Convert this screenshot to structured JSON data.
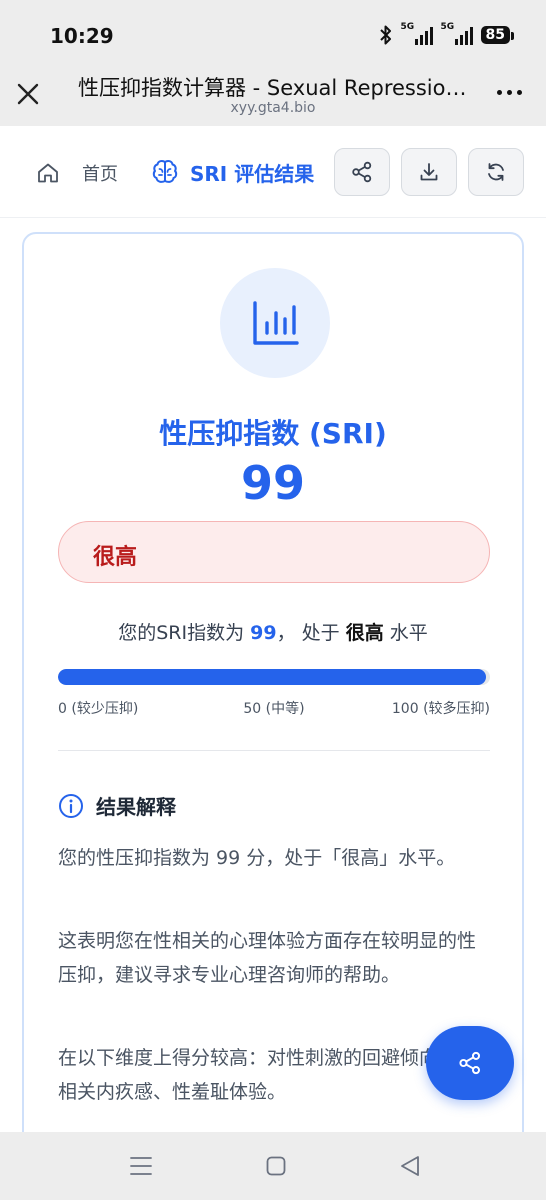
{
  "status_bar": {
    "time": "10:29",
    "network_1": "5G",
    "network_2": "5G",
    "battery": "85"
  },
  "browser": {
    "title": "性压抑指数计算器 - Sexual Repression Index",
    "url": "xyy.gta4.bio"
  },
  "nav": {
    "home_label": "首页",
    "current_label": "SRI 评估结果"
  },
  "result": {
    "title": "性压抑指数 (SRI)",
    "score": "99",
    "level": "很高",
    "summary_prefix": "您的SRI指数为",
    "summary_score": "99",
    "summary_middle": "， 处于",
    "summary_level": "很高",
    "summary_suffix": "水平",
    "progress_fraction": 0.99,
    "scale_low": "0 (较少压抑)",
    "scale_mid": "50 (中等)",
    "scale_high": "100 (较多压抑)"
  },
  "interpretation": {
    "heading": "结果解释",
    "paragraphs": [
      "您的性压抑指数为 99 分，处于「很高」水平。",
      "这表明您在性相关的心理体验方面存在较明显的性压抑，建议寻求专业心理咨询师的帮助。",
      "在以下维度上得分较高：对性刺激的回避倾向、性相关内疚感、性羞耻体验。"
    ]
  },
  "colors": {
    "accent": "#2563eb",
    "danger_text": "#b91c1c",
    "danger_bg": "#fdecec"
  },
  "icons": {
    "home": "home-icon",
    "brain": "brain-icon",
    "share": "share-icon",
    "download": "download-icon",
    "refresh": "refresh-icon",
    "chart": "bar-chart-icon",
    "info": "info-icon"
  }
}
